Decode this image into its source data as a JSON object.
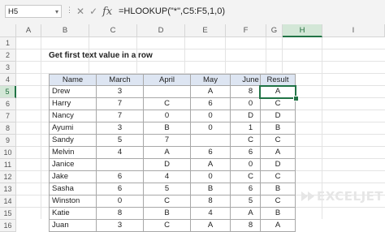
{
  "formula_bar": {
    "name_box": "H5",
    "formula": "=HLOOKUP(\"*\",C5:F5,1,0)",
    "icons": [
      "dots-icon",
      "cancel-icon",
      "enter-icon",
      "fx-icon"
    ]
  },
  "columns": [
    "A",
    "B",
    "C",
    "D",
    "E",
    "F",
    "G",
    "H",
    "I"
  ],
  "rows": [
    "1",
    "2",
    "3",
    "4",
    "5",
    "6",
    "7",
    "8",
    "9",
    "10",
    "11",
    "12",
    "13",
    "14",
    "15",
    "16"
  ],
  "title": "Get first text value in a row",
  "table": {
    "headers": [
      "Name",
      "March",
      "April",
      "May",
      "June"
    ],
    "rows": [
      [
        "Drew",
        "3",
        "",
        "A",
        "8"
      ],
      [
        "Harry",
        "7",
        "C",
        "6",
        "0"
      ],
      [
        "Nancy",
        "7",
        "0",
        "0",
        "D"
      ],
      [
        "Ayumi",
        "3",
        "B",
        "0",
        "1"
      ],
      [
        "Sandy",
        "5",
        "7",
        "",
        "C"
      ],
      [
        "Melvin",
        "4",
        "A",
        "6",
        "6"
      ],
      [
        "Janice",
        "",
        "D",
        "A",
        "0"
      ],
      [
        "Jake",
        "6",
        "4",
        "0",
        "C"
      ],
      [
        "Sasha",
        "6",
        "5",
        "B",
        "6"
      ],
      [
        "Winston",
        "0",
        "C",
        "8",
        "5"
      ],
      [
        "Katie",
        "8",
        "B",
        "4",
        "A"
      ],
      [
        "Juan",
        "3",
        "C",
        "A",
        "8"
      ]
    ]
  },
  "result": {
    "header": "Result",
    "values": [
      "A",
      "C",
      "D",
      "B",
      "C",
      "A",
      "D",
      "C",
      "B",
      "C",
      "B",
      "A"
    ]
  },
  "logo": {
    "text": "EXCELJET",
    "color": "#e6e6e6"
  },
  "colors": {
    "accent": "#217346",
    "header_fill": "#dde5f2"
  }
}
